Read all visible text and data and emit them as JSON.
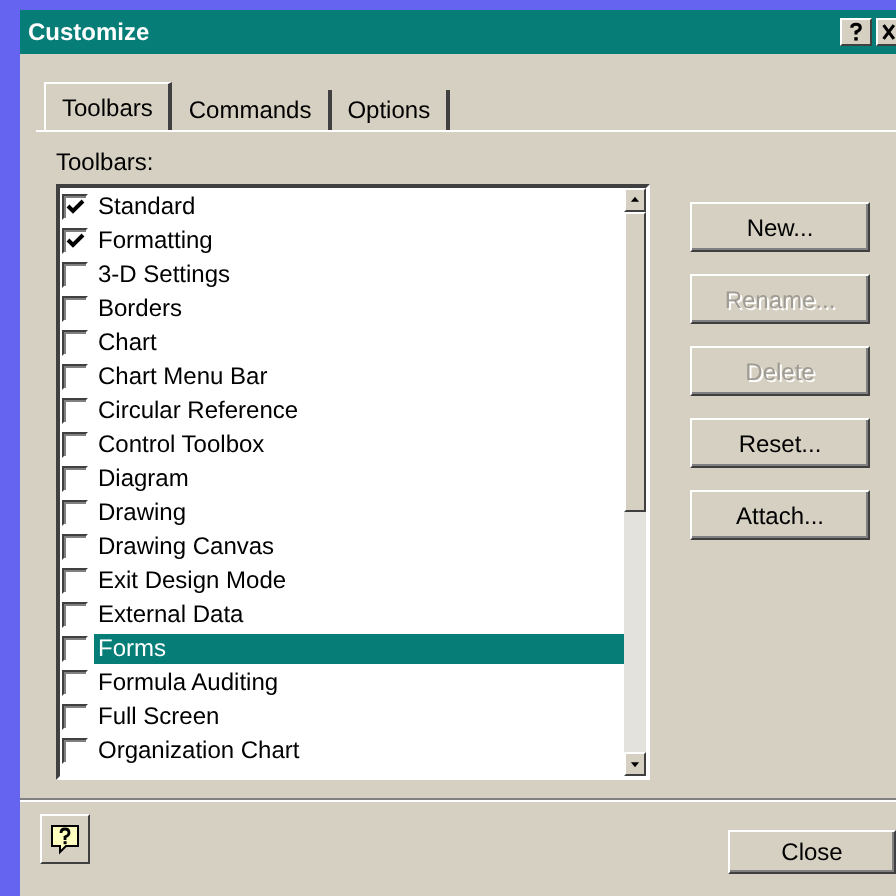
{
  "window": {
    "title": "Customize"
  },
  "tabs": [
    {
      "label": "Toolbars",
      "selected": true
    },
    {
      "label": "Commands",
      "selected": false
    },
    {
      "label": "Options",
      "selected": false
    }
  ],
  "toolbars_label": "Toolbars:",
  "toolbars": [
    {
      "label": "Standard",
      "checked": true,
      "selected": false
    },
    {
      "label": "Formatting",
      "checked": true,
      "selected": false
    },
    {
      "label": "3-D Settings",
      "checked": false,
      "selected": false
    },
    {
      "label": "Borders",
      "checked": false,
      "selected": false
    },
    {
      "label": "Chart",
      "checked": false,
      "selected": false
    },
    {
      "label": "Chart Menu Bar",
      "checked": false,
      "selected": false
    },
    {
      "label": "Circular Reference",
      "checked": false,
      "selected": false
    },
    {
      "label": "Control Toolbox",
      "checked": false,
      "selected": false
    },
    {
      "label": "Diagram",
      "checked": false,
      "selected": false
    },
    {
      "label": "Drawing",
      "checked": false,
      "selected": false
    },
    {
      "label": "Drawing Canvas",
      "checked": false,
      "selected": false
    },
    {
      "label": "Exit Design Mode",
      "checked": false,
      "selected": false
    },
    {
      "label": "External Data",
      "checked": false,
      "selected": false
    },
    {
      "label": "Forms",
      "checked": false,
      "selected": true
    },
    {
      "label": "Formula Auditing",
      "checked": false,
      "selected": false
    },
    {
      "label": "Full Screen",
      "checked": false,
      "selected": false
    },
    {
      "label": "Organization Chart",
      "checked": false,
      "selected": false
    }
  ],
  "buttons": [
    {
      "label": "New...",
      "disabled": false
    },
    {
      "label": "Rename...",
      "disabled": true
    },
    {
      "label": "Delete",
      "disabled": true
    },
    {
      "label": "Reset...",
      "disabled": false
    },
    {
      "label": "Attach...",
      "disabled": false
    }
  ],
  "close_button": "Close"
}
